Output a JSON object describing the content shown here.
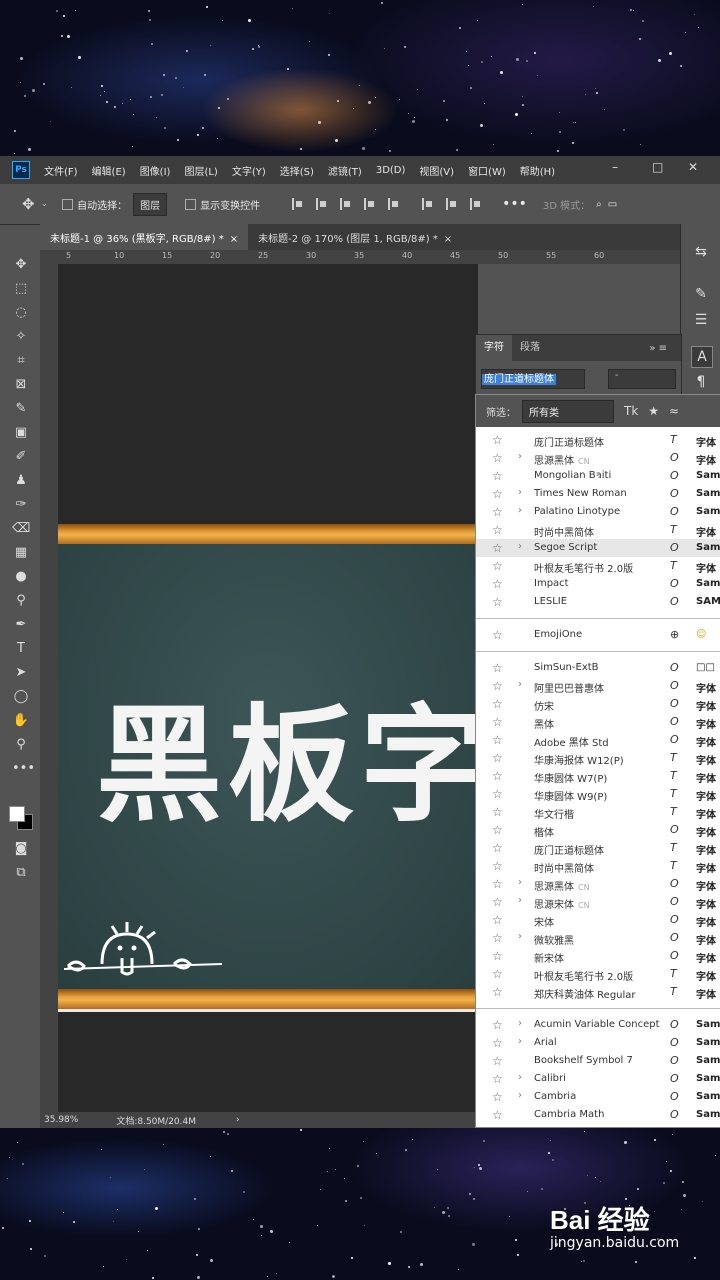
{
  "menubar": {
    "app_icon": "Ps",
    "items": [
      "文件(F)",
      "编辑(E)",
      "图像(I)",
      "图层(L)",
      "文字(Y)",
      "选择(S)",
      "滤镜(T)",
      "3D(D)",
      "视图(V)",
      "窗口(W)",
      "帮助(H)"
    ]
  },
  "options": {
    "auto_select_label": "自动选择：",
    "auto_select_value": "图层",
    "show_transform_label": "显示变换控件",
    "mode_label": "3D 模式："
  },
  "tabs": [
    {
      "label": "未标题-1 @ 36% (黑板字, RGB/8#) *",
      "close": "×"
    },
    {
      "label": "未标题-2 @ 170% (图层 1, RGB/8#) *",
      "close": "×"
    }
  ],
  "ruler": [
    "5",
    "10",
    "15",
    "20",
    "25",
    "30",
    "35",
    "40",
    "45",
    "50",
    "55",
    "60"
  ],
  "canvas": {
    "text": "黑板字"
  },
  "status": {
    "zoom": "35.98%",
    "doc": "文档:8.50M/20.4M",
    "arrow": "›"
  },
  "char_panel": {
    "tabs": [
      "字符",
      "段落"
    ],
    "font_value": "庞门正道标题体",
    "style_value": "-"
  },
  "font_list": {
    "filter_label": "筛选：",
    "filter_value": "所有类",
    "recent": [
      {
        "name": "庞门正道标题体",
        "tag": "",
        "arrow": "",
        "type": "T",
        "sample": "字体"
      },
      {
        "name": "思源黑体",
        "tag": "CN",
        "arrow": "›",
        "type": "O",
        "sample": "字体"
      },
      {
        "name": "Mongolian Baiti",
        "tag": "",
        "arrow": "",
        "type": "O",
        "sample": "Sam"
      },
      {
        "name": "Times New Roman",
        "tag": "",
        "arrow": "›",
        "type": "O",
        "sample": "Sam"
      },
      {
        "name": "Palatino Linotype",
        "tag": "",
        "arrow": "›",
        "type": "O",
        "sample": "Sam"
      },
      {
        "name": "时尚中黑简体",
        "tag": "",
        "arrow": "",
        "type": "T",
        "sample": "字体"
      },
      {
        "name": "Segoe Script",
        "tag": "",
        "arrow": "›",
        "type": "O",
        "sample": "Sam",
        "highlight": true
      },
      {
        "name": "叶根友毛笔行书 2.0版",
        "tag": "",
        "arrow": "",
        "type": "T",
        "sample": "字体"
      },
      {
        "name": "Impact",
        "tag": "",
        "arrow": "",
        "type": "O",
        "sample": "Sam"
      },
      {
        "name": "LESLIE",
        "tag": "",
        "arrow": "",
        "type": "O",
        "sample": "SAM"
      }
    ],
    "emoji": {
      "name": "EmojiOne",
      "sample": "☺"
    },
    "cjk": [
      {
        "name": "SimSun-ExtB",
        "tag": "",
        "arrow": "",
        "type": "O",
        "sample": "□□"
      },
      {
        "name": "阿里巴巴普惠体",
        "tag": "",
        "arrow": "›",
        "type": "O",
        "sample": "字体"
      },
      {
        "name": "仿宋",
        "tag": "",
        "arrow": "",
        "type": "O",
        "sample": "字体"
      },
      {
        "name": "黑体",
        "tag": "",
        "arrow": "",
        "type": "O",
        "sample": "字体"
      },
      {
        "name": "Adobe 黑体 Std",
        "tag": "",
        "arrow": "",
        "type": "O",
        "sample": "字体"
      },
      {
        "name": "华康海报体 W12(P)",
        "tag": "",
        "arrow": "",
        "type": "T",
        "sample": "字体"
      },
      {
        "name": "华康圆体 W7(P)",
        "tag": "",
        "arrow": "",
        "type": "T",
        "sample": "字体"
      },
      {
        "name": "华康圆体 W9(P)",
        "tag": "",
        "arrow": "",
        "type": "T",
        "sample": "字体"
      },
      {
        "name": "华文行楷",
        "tag": "",
        "arrow": "",
        "type": "T",
        "sample": "字体"
      },
      {
        "name": "楷体",
        "tag": "",
        "arrow": "",
        "type": "O",
        "sample": "字体"
      },
      {
        "name": "庞门正道标题体",
        "tag": "",
        "arrow": "",
        "type": "T",
        "sample": "字体"
      },
      {
        "name": "时尚中黑简体",
        "tag": "",
        "arrow": "",
        "type": "T",
        "sample": "字体"
      },
      {
        "name": "思源黑体",
        "tag": "CN",
        "arrow": "›",
        "type": "O",
        "sample": "字体"
      },
      {
        "name": "思源宋体",
        "tag": "CN",
        "arrow": "›",
        "type": "O",
        "sample": "字体"
      },
      {
        "name": "宋体",
        "tag": "",
        "arrow": "",
        "type": "O",
        "sample": "字体"
      },
      {
        "name": "微软雅黑",
        "tag": "",
        "arrow": "›",
        "type": "O",
        "sample": "字体"
      },
      {
        "name": "新宋体",
        "tag": "",
        "arrow": "",
        "type": "O",
        "sample": "字体"
      },
      {
        "name": "叶根友毛笔行书 2.0版",
        "tag": "",
        "arrow": "",
        "type": "T",
        "sample": "字体"
      },
      {
        "name": "郑庆科黄油体 Regular",
        "tag": "",
        "arrow": "",
        "type": "T",
        "sample": "字体"
      }
    ],
    "latin": [
      {
        "name": "Acumin Variable Concept",
        "tag": "",
        "arrow": "›",
        "type": "O",
        "sample": "Sample"
      },
      {
        "name": "Arial",
        "tag": "",
        "arrow": "›",
        "type": "O",
        "sample": "Sam"
      },
      {
        "name": "Bookshelf Symbol 7",
        "tag": "",
        "arrow": "",
        "type": "O",
        "sample": "Sam"
      },
      {
        "name": "Calibri",
        "tag": "",
        "arrow": "›",
        "type": "O",
        "sample": "Sam"
      },
      {
        "name": "Cambria",
        "tag": "",
        "arrow": "›",
        "type": "O",
        "sample": "Sam"
      },
      {
        "name": "Cambria Math",
        "tag": "",
        "arrow": "",
        "type": "O",
        "sample": "Sam"
      }
    ]
  },
  "watermark": {
    "logo": "Bai 经验",
    "url": "jingyan.baidu.com"
  }
}
